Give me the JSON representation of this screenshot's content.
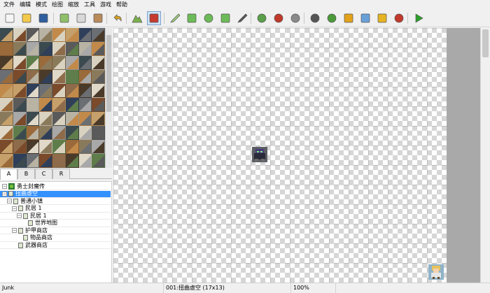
{
  "menu": [
    "文件",
    "编辑",
    "模式",
    "绘图",
    "缩放",
    "工具",
    "游戏",
    "帮助"
  ],
  "toolbar": {
    "buttons": [
      {
        "name": "new-file-icon",
        "color": "#f5f5f5"
      },
      {
        "name": "open-folder-icon",
        "color": "#f2c94c"
      },
      {
        "name": "save-icon",
        "color": "#2f5f9e"
      },
      {
        "name": "cut-icon",
        "color": "#8fbf6a"
      },
      {
        "name": "copy-icon",
        "color": "#d8d8d8"
      },
      {
        "name": "paste-icon",
        "color": "#b98b5a"
      },
      {
        "name": "undo-icon",
        "color": "#d8a21e"
      },
      {
        "name": "map-layer-icon",
        "color": "#7ab24a"
      },
      {
        "name": "event-layer-icon",
        "color": "#c63b2f"
      },
      {
        "name": "pencil-icon",
        "color": "#9ccf7a"
      },
      {
        "name": "rectangle-icon",
        "color": "#6dbb58"
      },
      {
        "name": "ellipse-icon",
        "color": "#6dbb58"
      },
      {
        "name": "fill-icon",
        "color": "#6dbb58"
      },
      {
        "name": "select-icon",
        "color": "#555555"
      },
      {
        "name": "zoom-in-icon",
        "color": "#5aa04a"
      },
      {
        "name": "zoom-out-icon",
        "color": "#c0392b"
      },
      {
        "name": "zoom-reset-icon",
        "color": "#8a8a8a"
      },
      {
        "name": "gear-icon",
        "color": "#555555"
      },
      {
        "name": "puzzle-icon",
        "color": "#4a9a3a"
      },
      {
        "name": "sound-icon",
        "color": "#e3a21a"
      },
      {
        "name": "resource-icon",
        "color": "#6aa0d8"
      },
      {
        "name": "script-icon",
        "color": "#e6b422"
      },
      {
        "name": "character-icon",
        "color": "#c0392b"
      },
      {
        "name": "play-icon",
        "color": "#2aa02a"
      }
    ]
  },
  "layers": [
    "A",
    "B",
    "C",
    "R"
  ],
  "tree": [
    {
      "label": "勇士封魔传",
      "depth": 0,
      "toggle": "⊟",
      "icon": "game"
    },
    {
      "label": "扭曲虚空",
      "depth": 0,
      "toggle": "⊟",
      "icon": "map",
      "selected": true
    },
    {
      "label": "普通小镇",
      "depth": 1,
      "toggle": "⊟",
      "icon": "map"
    },
    {
      "label": "民居 1",
      "depth": 2,
      "toggle": "⊟",
      "icon": "map"
    },
    {
      "label": "民居 1",
      "depth": 3,
      "toggle": "⊟",
      "icon": "map"
    },
    {
      "label": "世界地图",
      "depth": 4,
      "toggle": "",
      "icon": "map"
    },
    {
      "label": "护甲商店",
      "depth": 2,
      "toggle": "⊟",
      "icon": "map"
    },
    {
      "label": "物品商店",
      "depth": 3,
      "toggle": "",
      "icon": "map"
    },
    {
      "label": "武器商店",
      "depth": 2,
      "toggle": "",
      "icon": "map"
    }
  ],
  "tileset_palette": [
    "#3b4a4f",
    "#6b6f73",
    "#8a7a5c",
    "#c6a06a",
    "#5e7d4a",
    "#b9b3a4",
    "#4a3a2a",
    "#d9d2c0",
    "#7a4a2a",
    "#a8a8a8",
    "#2f3f5a",
    "#9a6a3a",
    "#c28a4a",
    "#e0d8c8",
    "#5a5a5a",
    "#8e6b4a"
  ],
  "status": {
    "mode": "Junk",
    "map_info": "001:扭曲虚空 (17x13)",
    "zoom": "100%"
  }
}
